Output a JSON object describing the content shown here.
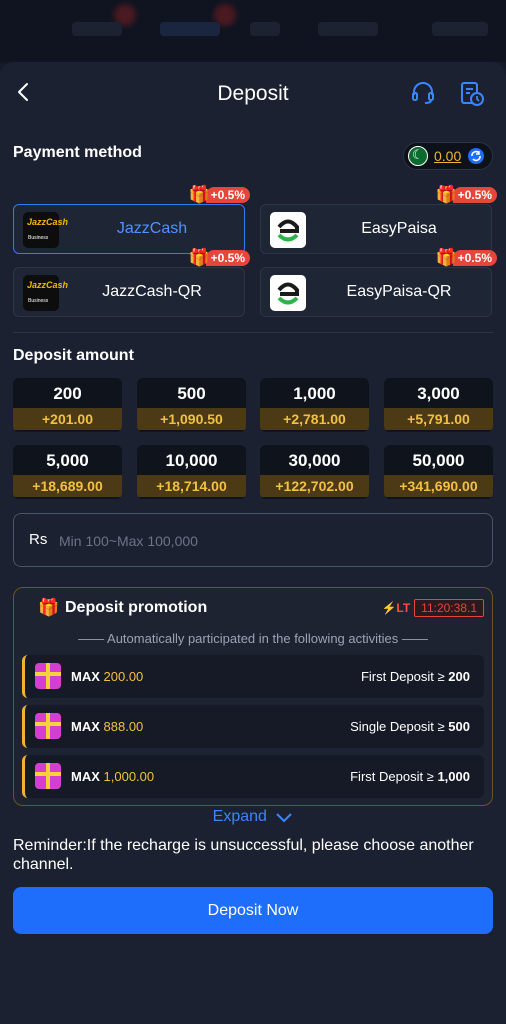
{
  "header": {
    "title": "Deposit"
  },
  "payment": {
    "section_title": "Payment method",
    "balance": "0.00",
    "methods": [
      {
        "label": "JazzCash",
        "bonus": "+0.5%",
        "logo": "jazzcash-logo"
      },
      {
        "label": "EasyPaisa",
        "bonus": "+0.5%",
        "logo": "easypaisa-logo"
      },
      {
        "label": "JazzCash-QR",
        "bonus": "+0.5%",
        "logo": "jazzcash-logo"
      },
      {
        "label": "EasyPaisa-QR",
        "bonus": "+0.5%",
        "logo": "easypaisa-logo"
      }
    ],
    "jazz_logo_text": "JazzCash",
    "jazz_logo_sub": "Business"
  },
  "deposit": {
    "section_title": "Deposit amount",
    "amounts": [
      {
        "value": "200",
        "bonus": "+201.00"
      },
      {
        "value": "500",
        "bonus": "+1,090.50"
      },
      {
        "value": "1,000",
        "bonus": "+2,781.00"
      },
      {
        "value": "3,000",
        "bonus": "+5,791.00"
      },
      {
        "value": "5,000",
        "bonus": "+18,689.00"
      },
      {
        "value": "10,000",
        "bonus": "+18,714.00"
      },
      {
        "value": "30,000",
        "bonus": "+122,702.00"
      },
      {
        "value": "50,000",
        "bonus": "+341,690.00"
      }
    ],
    "currency": "Rs",
    "placeholder": "Min 100~Max 100,000"
  },
  "promotion": {
    "title": "Deposit promotion",
    "timer_badge": "LT",
    "timer": "11:20:38.1",
    "subtitle": "—— Automatically participated in the following activities ——",
    "activities": [
      {
        "max_label": "MAX",
        "max_value": "200.00",
        "condition": "First Deposit ≥",
        "threshold": "200"
      },
      {
        "max_label": "MAX",
        "max_value": "888.00",
        "condition": "Single Deposit ≥",
        "threshold": "500"
      },
      {
        "max_label": "MAX",
        "max_value": "1,000.00",
        "condition": "First Deposit ≥",
        "threshold": "1,000"
      }
    ],
    "expand_label": "Expand"
  },
  "reminder": "Reminder:If the recharge is unsuccessful, please choose another channel.",
  "deposit_button": "Deposit Now",
  "colors": {
    "accent": "#1f6efb",
    "bonus_gold": "#f2c043",
    "tag_red": "#e6453a"
  }
}
